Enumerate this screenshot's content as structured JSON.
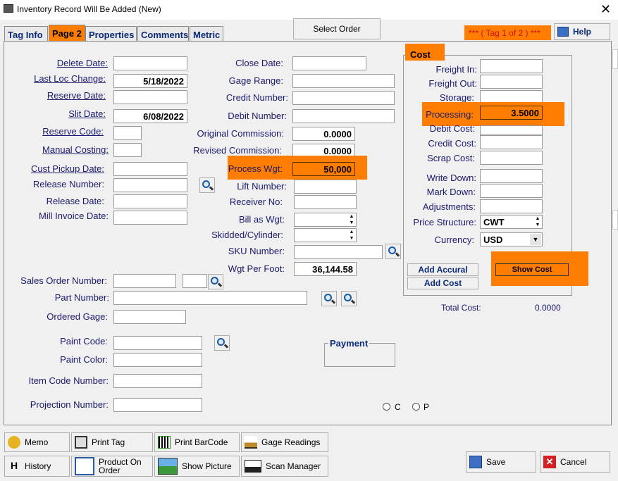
{
  "window": {
    "title": "Inventory Record Will Be Added  (New)",
    "close": "✕"
  },
  "tabs": [
    "Tag Info",
    "Page 2",
    "Properties",
    "Comments",
    "Metric"
  ],
  "header": {
    "select_order": "Select Order",
    "tag_indicator": "***    ( Tag 1 of 2 )   ***",
    "help": "Help"
  },
  "left": {
    "delete_date": {
      "label": "Delete Date:",
      "value": ""
    },
    "last_loc_change": {
      "label": "Last Loc Change:",
      "value": "5/18/2022"
    },
    "reserve_date": {
      "label": "Reserve Date:",
      "value": ""
    },
    "slit_date": {
      "label": "Slit Date:",
      "value": "6/08/2022"
    },
    "reserve_code": {
      "label": "Reserve Code:",
      "value": ""
    },
    "manual_costing": {
      "label": "Manual Costing:",
      "value": ""
    },
    "cust_pickup_date": {
      "label": "Cust Pickup Date:",
      "value": ""
    },
    "release_number": {
      "label": "Release Number:",
      "value": ""
    },
    "release_date": {
      "label": "Release Date:",
      "value": ""
    },
    "mill_invoice_date": {
      "label": "Mill Invoice Date:",
      "value": ""
    },
    "sales_order_number": {
      "label": "Sales Order Number:",
      "value": ""
    },
    "part_number": {
      "label": "Part Number:",
      "value": ""
    },
    "ordered_gage": {
      "label": "Ordered Gage:",
      "value": ""
    },
    "paint_code": {
      "label": "Paint Code:",
      "value": ""
    },
    "paint_color": {
      "label": "Paint Color:",
      "value": ""
    },
    "item_code_number": {
      "label": "Item Code Number:",
      "value": ""
    },
    "projection_number": {
      "label": "Projection Number:",
      "value": ""
    }
  },
  "middle": {
    "close_date": {
      "label": "Close Date:",
      "value": ""
    },
    "gage_range": {
      "label": "Gage Range:",
      "value": ""
    },
    "credit_number": {
      "label": "Credit Number:",
      "value": ""
    },
    "debit_number": {
      "label": "Debit Number:",
      "value": ""
    },
    "original_commission": {
      "label": "Original Commission:",
      "value": "0.0000"
    },
    "revised_commission": {
      "label": "Revised Commission:",
      "value": "0.0000"
    },
    "process_wgt": {
      "label": "Process Wgt:",
      "value": "50,000"
    },
    "lift_number": {
      "label": "Lift Number:",
      "value": ""
    },
    "receiver_no": {
      "label": "Receiver No:",
      "value": ""
    },
    "bill_as_wgt": {
      "label": "Bill as Wgt:",
      "value": ""
    },
    "skidded_cylinder": {
      "label": "Skidded/Cylinder:",
      "value": ""
    },
    "sku_number": {
      "label": "SKU Number:",
      "value": ""
    },
    "wgt_per_foot": {
      "label": "Wgt Per Foot:",
      "value": "36,144.58"
    }
  },
  "payment": {
    "title": "Payment",
    "radio_c": "C",
    "radio_p": "P"
  },
  "cost": {
    "title": "Cost",
    "freight_in": {
      "label": "Freight In:",
      "value": ""
    },
    "freight_out": {
      "label": "Freight Out:",
      "value": ""
    },
    "storage": {
      "label": "Storage:",
      "value": ""
    },
    "processing": {
      "label": "Processing:",
      "value": "3.5000"
    },
    "debit_cost": {
      "label": "Debit Cost:",
      "value": ""
    },
    "credit_cost": {
      "label": "Credit Cost:",
      "value": ""
    },
    "scrap_cost": {
      "label": "Scrap Cost:",
      "value": ""
    },
    "write_down": {
      "label": "Write Down:",
      "value": ""
    },
    "mark_down": {
      "label": "Mark Down:",
      "value": ""
    },
    "adjustments": {
      "label": "Adjustments:",
      "value": ""
    },
    "price_structure": {
      "label": "Price Structure:",
      "value": "CWT"
    },
    "currency": {
      "label": "Currency:",
      "value": "USD"
    },
    "add_accural": "Add Accural",
    "add_cost": "Add Cost",
    "show_cost": "Show Cost",
    "total_cost_label": "Total Cost:",
    "total_cost_value": "0.0000"
  },
  "bottom": {
    "memo": "Memo",
    "print_tag": "Print Tag",
    "print_barcode": "Print BarCode",
    "gage_readings": "Gage Readings",
    "history": "History",
    "history_key": "H",
    "product_on_order": "Product On\nOrder",
    "show_picture": "Show Picture",
    "scan_manager": "Scan Manager",
    "save": "Save",
    "cancel": "Cancel"
  },
  "colors": {
    "highlight": "#ff7d00",
    "label": "#1a1a6e",
    "tab_text": "#0a2a7a"
  }
}
